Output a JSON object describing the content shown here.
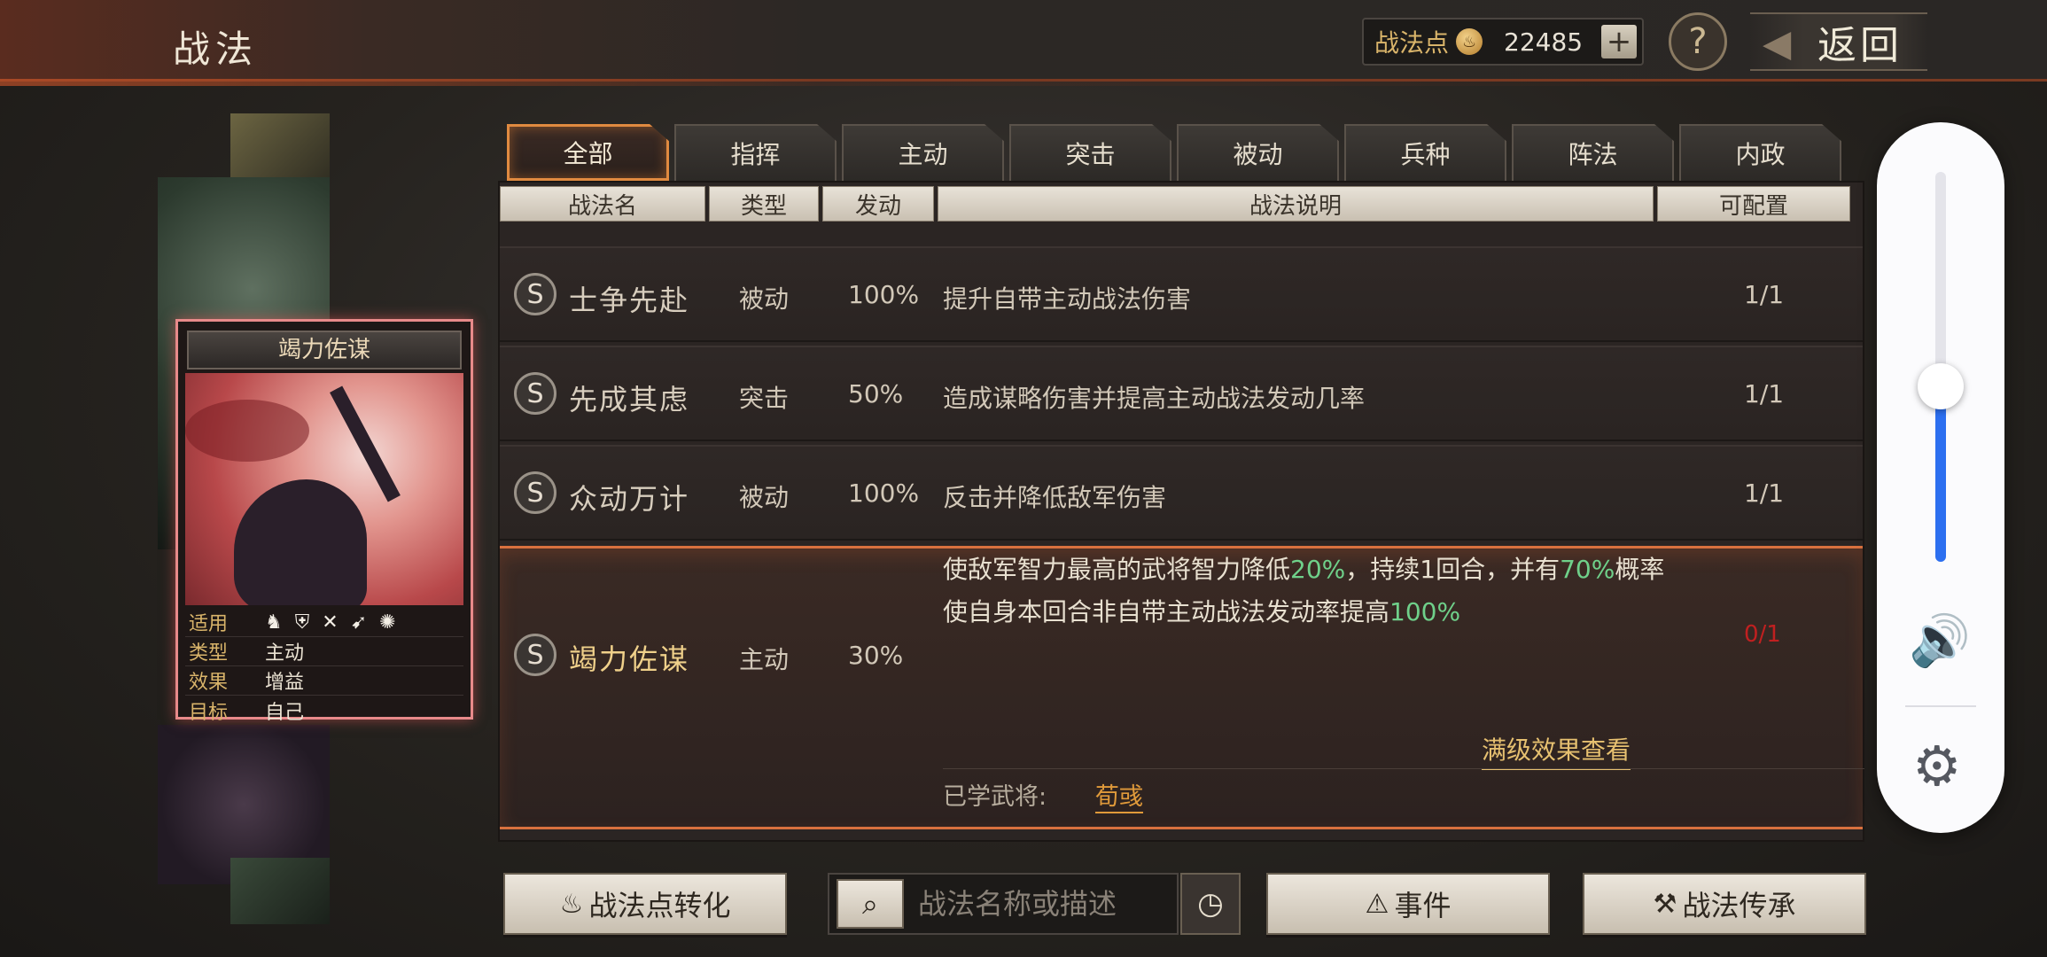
{
  "header": {
    "title": "战法",
    "points_label": "战法点",
    "points_value": "22485",
    "add_label": "+",
    "help_label": "?",
    "back_label": "返回"
  },
  "card": {
    "name": "竭力佐谋",
    "attrs": [
      {
        "label": "适用",
        "value": ""
      },
      {
        "label": "类型",
        "value": "主动"
      },
      {
        "label": "效果",
        "value": "增益"
      },
      {
        "label": "目标",
        "value": "自己"
      }
    ],
    "unit_icons": [
      "cavalry-icon",
      "shield-icon",
      "bow-icon",
      "spear-icon",
      "chariot-icon"
    ]
  },
  "tabs": [
    {
      "label": "全部",
      "active": true
    },
    {
      "label": "指挥"
    },
    {
      "label": "主动"
    },
    {
      "label": "突击"
    },
    {
      "label": "被动"
    },
    {
      "label": "兵种"
    },
    {
      "label": "阵法"
    },
    {
      "label": "内政"
    }
  ],
  "columns": {
    "name": "战法名",
    "type": "类型",
    "rate": "发动",
    "desc": "战法说明",
    "conf": "可配置"
  },
  "rows": [
    {
      "grade": "S",
      "name": "士争先赴",
      "type": "被动",
      "rate": "100%",
      "desc": "提升自带主动战法伤害",
      "conf": "1/1"
    },
    {
      "grade": "S",
      "name": "先成其虑",
      "type": "突击",
      "rate": "50%",
      "desc": "造成谋略伤害并提高主动战法发动几率",
      "conf": "1/1"
    },
    {
      "grade": "S",
      "name": "众动万计",
      "type": "被动",
      "rate": "100%",
      "desc": "反击并降低敌军伤害",
      "conf": "1/1"
    }
  ],
  "expanded": {
    "grade": "S",
    "name": "竭力佐谋",
    "type": "主动",
    "rate": "30%",
    "desc_parts": [
      {
        "text": "使敌军智力最高的武将智力降低"
      },
      {
        "text": "20%",
        "green": true
      },
      {
        "text": "，持续1回合，并有"
      },
      {
        "text": "70%",
        "green": true
      },
      {
        "text": "概率使自身本回合非自带主动战法发动率提高"
      },
      {
        "text": "100%",
        "green": true
      }
    ],
    "conf": "0/1",
    "conf_color": "#c02020",
    "fullview_label": "满级效果查看",
    "learned_label": "已学武将:",
    "learned_name": "荀彧"
  },
  "bottom": {
    "convert_label": "战法点转化",
    "search_placeholder": "战法名称或描述",
    "event_label": "事件",
    "inherit_label": "战法传承"
  },
  "volume": {
    "level": 0.45,
    "accent": "#2c6ff0"
  }
}
